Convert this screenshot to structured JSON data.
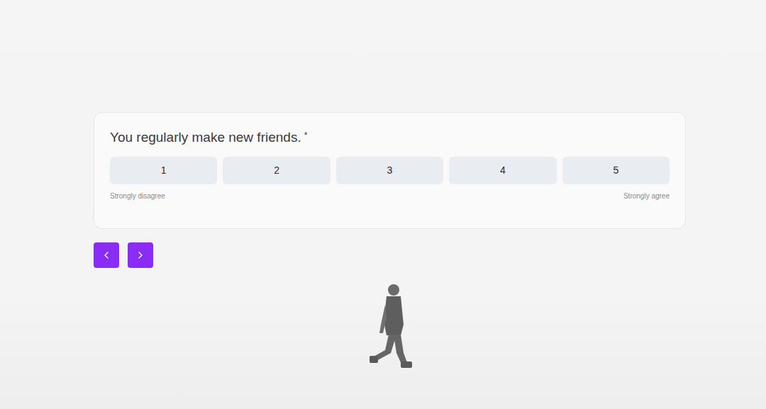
{
  "question": {
    "title": "You regularly make new friends.",
    "required_mark": "*",
    "options": [
      {
        "label": "1",
        "selected": false
      },
      {
        "label": "2",
        "selected": false
      },
      {
        "label": "3",
        "selected": false
      },
      {
        "label": "4",
        "selected": false
      },
      {
        "label": "5",
        "selected": false
      }
    ],
    "scale_labels": {
      "min": "Strongly disagree",
      "max": "Strongly agree"
    }
  }
}
